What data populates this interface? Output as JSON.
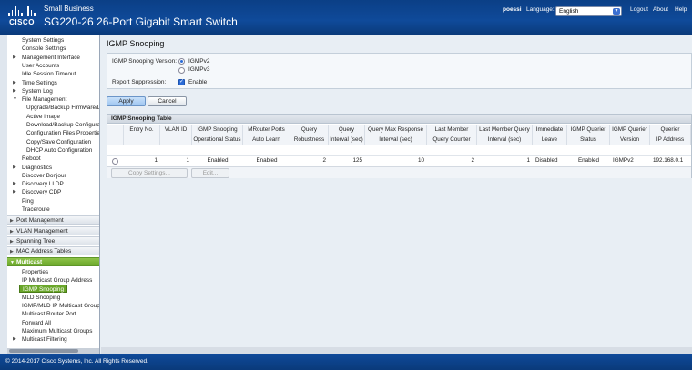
{
  "header": {
    "logo_text": "CISCO",
    "brand_line1": "Small Business",
    "brand_line2": "SG220-26 26-Port Gigabit Smart Switch",
    "user": "poessi",
    "language_label": "Language:",
    "language_value": "English",
    "links": [
      "Logout",
      "About",
      "Help"
    ]
  },
  "sidebar": {
    "items": [
      {
        "label": "System Settings",
        "indent": 1,
        "expander": false
      },
      {
        "label": "Console Settings",
        "indent": 1,
        "expander": false
      },
      {
        "label": "Management Interface",
        "indent": 1,
        "expander": true
      },
      {
        "label": "User Accounts",
        "indent": 1,
        "expander": false
      },
      {
        "label": "Idle Session Timeout",
        "indent": 1,
        "expander": false
      },
      {
        "label": "Time Settings",
        "indent": 1,
        "expander": true
      },
      {
        "label": "System Log",
        "indent": 1,
        "expander": true
      },
      {
        "label": "File Management",
        "indent": 1,
        "expander": true,
        "open": true
      },
      {
        "label": "Upgrade/Backup Firmware/L",
        "indent": 2,
        "expander": false
      },
      {
        "label": "Active Image",
        "indent": 2,
        "expander": false
      },
      {
        "label": "Download/Backup Configura",
        "indent": 2,
        "expander": false
      },
      {
        "label": "Configuration Files Propertie",
        "indent": 2,
        "expander": false
      },
      {
        "label": "Copy/Save Configuration",
        "indent": 2,
        "expander": false
      },
      {
        "label": "DHCP Auto Configuration",
        "indent": 2,
        "expander": false
      },
      {
        "label": "Reboot",
        "indent": 1,
        "expander": false
      },
      {
        "label": "Diagnostics",
        "indent": 1,
        "expander": true
      },
      {
        "label": "Discover Bonjour",
        "indent": 1,
        "expander": false
      },
      {
        "label": "Discovery LLDP",
        "indent": 1,
        "expander": true
      },
      {
        "label": "Discovery CDP",
        "indent": 1,
        "expander": true
      },
      {
        "label": "Ping",
        "indent": 1,
        "expander": false
      },
      {
        "label": "Traceroute",
        "indent": 1,
        "expander": false
      }
    ],
    "sections": [
      "Port Management",
      "VLAN Management",
      "Spanning Tree",
      "MAC Address Tables",
      "Multicast"
    ],
    "multicast_items": [
      "Properties",
      "IP Multicast Group Address",
      "IGMP Snooping",
      "MLD Snooping",
      "IGMP/MLD IP Multicast Group",
      "Multicast Router Port",
      "Forward All",
      "Maximum Multicast Groups",
      "Multicast Filtering"
    ],
    "selected": "IGMP Snooping"
  },
  "main": {
    "title": "IGMP Snooping",
    "version_label": "IGMP Snooping Version:",
    "version_options": [
      "IGMPv2",
      "IGMPv3"
    ],
    "version_selected": "IGMPv2",
    "report_suppression_label": "Report Suppression:",
    "report_suppression_option": "Enable",
    "report_suppression_checked": true,
    "apply_label": "Apply",
    "cancel_label": "Cancel",
    "table": {
      "title": "IGMP Snooping Table",
      "headers": [
        [
          "Entry No.",
          ""
        ],
        [
          "VLAN ID",
          ""
        ],
        [
          "IGMP Snooping",
          "Operational Status"
        ],
        [
          "MRouter Ports",
          "Auto Learn"
        ],
        [
          "Query",
          "Robustness"
        ],
        [
          "Query",
          "Interval (sec)"
        ],
        [
          "Query Max Response",
          "Interval (sec)"
        ],
        [
          "Last Member",
          "Query Counter"
        ],
        [
          "Last Member Query",
          "Interval (sec)"
        ],
        [
          "Immediate",
          "Leave"
        ],
        [
          "IGMP Querier",
          "Status"
        ],
        [
          "IGMP Querier",
          "Version"
        ],
        [
          "Querier",
          "IP Address"
        ]
      ],
      "rows": [
        [
          "1",
          "1",
          "Enabled",
          "Enabled",
          "2",
          "125",
          "10",
          "2",
          "1",
          "Disabled",
          "Enabled",
          "IGMPv2",
          "192.168.0.1"
        ]
      ],
      "copy_settings_label": "Copy Settings...",
      "edit_label": "Edit..."
    }
  },
  "footer": {
    "copyright": "© 2014-2017 Cisco Systems, Inc. All Rights Reserved."
  }
}
